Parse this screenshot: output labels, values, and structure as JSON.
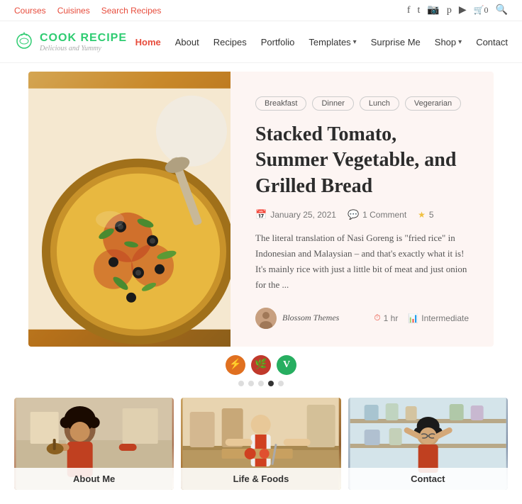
{
  "topbar": {
    "links": [
      "Courses",
      "Cuisines",
      "Search Recipes"
    ],
    "icons": [
      "f",
      "t",
      "i",
      "p",
      "y"
    ],
    "cart_label": "🛒0",
    "search_label": "🔍"
  },
  "header": {
    "logo_icon": "🍽",
    "logo_main": "COOK RECIPE",
    "logo_sub": "Delicious and Yummy",
    "nav_items": [
      {
        "label": "Home",
        "active": true
      },
      {
        "label": "About",
        "active": false
      },
      {
        "label": "Recipes",
        "active": false
      },
      {
        "label": "Portfolio",
        "active": false
      },
      {
        "label": "Templates",
        "active": false,
        "has_dropdown": true
      },
      {
        "label": "Surprise Me",
        "active": false
      },
      {
        "label": "Shop",
        "active": false,
        "has_dropdown": true
      },
      {
        "label": "Contact",
        "active": false
      }
    ]
  },
  "hero": {
    "tags": [
      "Breakfast",
      "Dinner",
      "Lunch",
      "Vegerarian"
    ],
    "title": "Stacked Tomato, Summer Vegetable, and Grilled Bread",
    "date": "January 25, 2021",
    "comments": "1 Comment",
    "rating": "5",
    "excerpt": "The literal translation of Nasi Goreng is \"fried rice\" in Indonesian and Malaysian – and that's exactly what it is! It's mainly rice with just a little bit of meat and just onion for the ...",
    "author": "Blossom Themes",
    "time": "1 hr",
    "difficulty": "Intermediate",
    "diet_badges": [
      "⚡",
      "🌿",
      "V"
    ],
    "diet_colors": [
      "#e07020",
      "#c0392b",
      "#27ae60"
    ]
  },
  "carousel": {
    "dots": [
      false,
      false,
      false,
      true,
      false
    ]
  },
  "bottom_cards": [
    {
      "label": "About Me"
    },
    {
      "label": "Life & Foods"
    },
    {
      "label": "Contact"
    }
  ]
}
